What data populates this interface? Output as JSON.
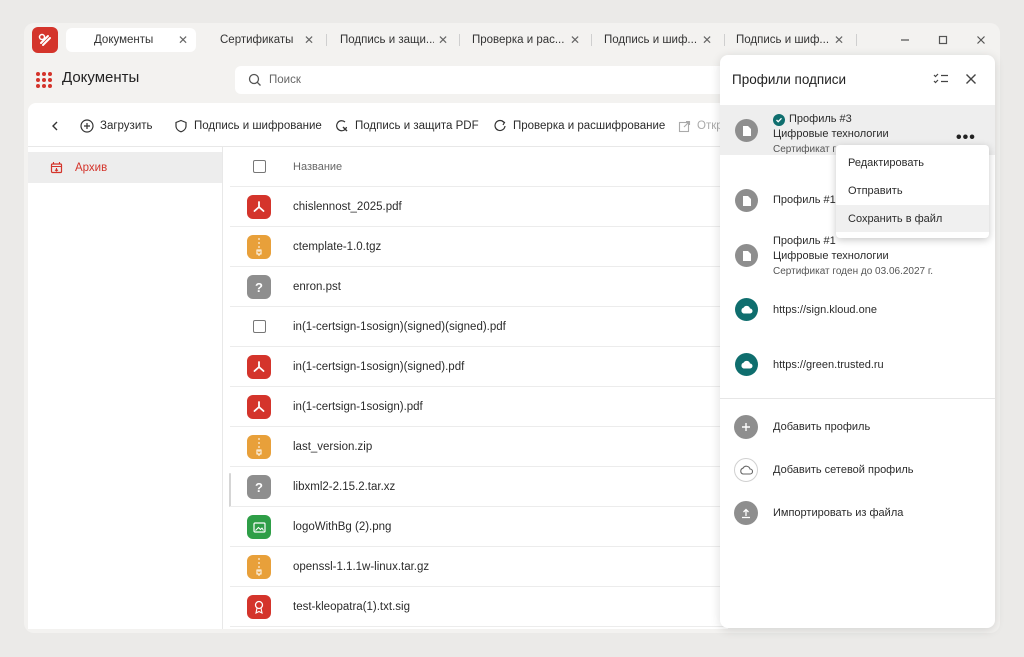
{
  "tabs": [
    {
      "label": "Документы",
      "active": true
    },
    {
      "label": "Сертификаты"
    },
    {
      "label": "Подпись и защи..."
    },
    {
      "label": "Проверка и рас..."
    },
    {
      "label": "Подпись и шиф..."
    },
    {
      "label": "Подпись и шиф..."
    }
  ],
  "header": {
    "title": "Документы",
    "search_placeholder": "Поиск"
  },
  "toolbar": {
    "upload": "Загрузить",
    "sign_encrypt": "Подпись и шифрование",
    "sign_pdf": "Подпись и защита PDF",
    "verify_decrypt": "Проверка и расшифрование",
    "open": "Откр"
  },
  "sidebar": {
    "archive": "Архив"
  },
  "files": {
    "column_name": "Название",
    "rows": [
      {
        "name": "chislennost_2025.pdf",
        "type": "pdf"
      },
      {
        "name": "ctemplate-1.0.tgz",
        "type": "zip"
      },
      {
        "name": "enron.pst",
        "type": "unknown"
      },
      {
        "name": "in(1-certsign-1sosign)(signed)(signed).pdf",
        "type": "checkbox"
      },
      {
        "name": "in(1-certsign-1sosign)(signed).pdf",
        "type": "pdf"
      },
      {
        "name": "in(1-certsign-1sosign).pdf",
        "type": "pdf"
      },
      {
        "name": "last_version.zip",
        "type": "zip"
      },
      {
        "name": "libxml2-2.15.2.tar.xz",
        "type": "unknown"
      },
      {
        "name": "logoWithBg (2).png",
        "type": "image"
      },
      {
        "name": "openssl-1.1.1w-linux.tar.gz",
        "type": "zip"
      },
      {
        "name": "test-kleopatra(1).txt.sig",
        "type": "sig"
      }
    ]
  },
  "panel": {
    "title": "Профили подписи",
    "profiles": [
      {
        "name": "Профиль #3",
        "org": "Цифровые технологии",
        "cert": "Сертификат г"
      },
      {
        "name": "Профиль #1"
      },
      {
        "name": "Профиль #1",
        "org": "Цифровые технологии",
        "cert": "Сертификат годен до 03.06.2027 г."
      },
      {
        "name": "https://sign.kloud.one"
      },
      {
        "name": "https://green.trusted.ru"
      }
    ],
    "actions": {
      "add": "Добавить профиль",
      "add_network": "Добавить сетевой профиль",
      "import": "Импортировать из файла"
    }
  },
  "context_menu": {
    "edit": "Редактировать",
    "send": "Отправить",
    "save": "Сохранить в файл"
  },
  "colors": {
    "brand": "#d4342b",
    "pdf": "#d4342b",
    "zip": "#e8a03a",
    "unknown": "#8e8e8e",
    "image": "#2e9e47",
    "teal": "#0f6e6e"
  }
}
